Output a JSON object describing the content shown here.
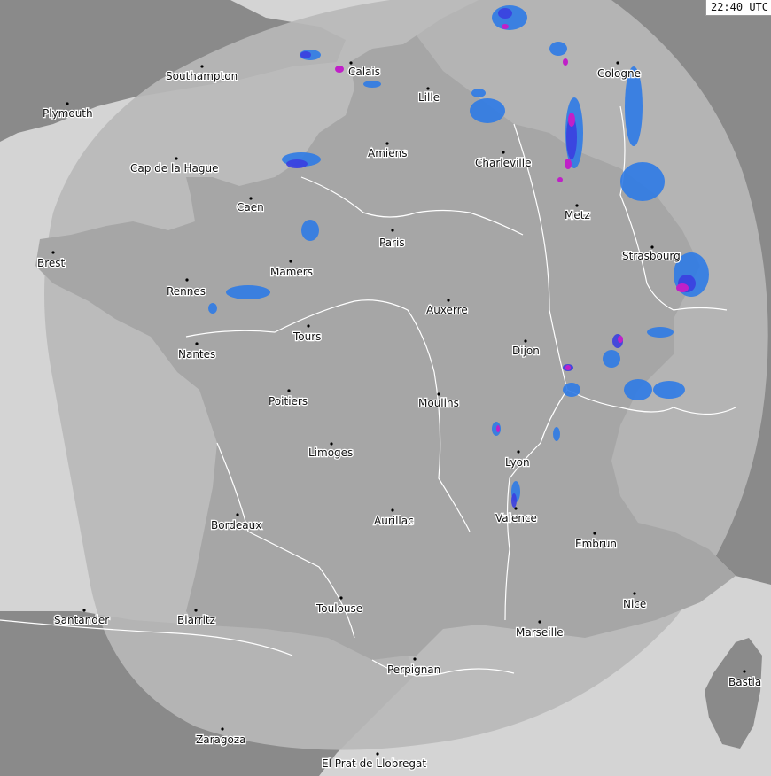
{
  "timestamp": "22:40 UTC",
  "colors": {
    "sea": "#d4d4d4",
    "foreign_land": "#8a8a8a",
    "radar_coverage": "#b8b8b8",
    "france_land": "#a6a6a6",
    "rivers_borders": "#ffffff",
    "precip_light": "#2f7be6",
    "precip_moderate": "#3b3fe0",
    "precip_heavy": "#c020c8"
  },
  "cities": [
    {
      "id": "southampton",
      "name": "Southampton"
    },
    {
      "id": "plymouth",
      "name": "Plymouth"
    },
    {
      "id": "calais",
      "name": "Calais"
    },
    {
      "id": "lille",
      "name": "Lille"
    },
    {
      "id": "cologne",
      "name": "Cologne"
    },
    {
      "id": "amiens",
      "name": "Amiens"
    },
    {
      "id": "charleville",
      "name": "Charleville"
    },
    {
      "id": "cap-de-la-hague",
      "name": "Cap de la Hague"
    },
    {
      "id": "caen",
      "name": "Caen"
    },
    {
      "id": "metz",
      "name": "Metz"
    },
    {
      "id": "paris",
      "name": "Paris"
    },
    {
      "id": "brest",
      "name": "Brest"
    },
    {
      "id": "strasbourg",
      "name": "Strasbourg"
    },
    {
      "id": "mamers",
      "name": "Mamers"
    },
    {
      "id": "rennes",
      "name": "Rennes"
    },
    {
      "id": "auxerre",
      "name": "Auxerre"
    },
    {
      "id": "tours",
      "name": "Tours"
    },
    {
      "id": "dijon",
      "name": "Dijon"
    },
    {
      "id": "nantes",
      "name": "Nantes"
    },
    {
      "id": "poitiers",
      "name": "Poitiers"
    },
    {
      "id": "moulins",
      "name": "Moulins"
    },
    {
      "id": "limoges",
      "name": "Limoges"
    },
    {
      "id": "lyon",
      "name": "Lyon"
    },
    {
      "id": "valence",
      "name": "Valence"
    },
    {
      "id": "bordeaux",
      "name": "Bordeaux"
    },
    {
      "id": "aurillac",
      "name": "Aurillac"
    },
    {
      "id": "embrun",
      "name": "Embrun"
    },
    {
      "id": "nice",
      "name": "Nice"
    },
    {
      "id": "santander",
      "name": "Santander"
    },
    {
      "id": "biarritz",
      "name": "Biarritz"
    },
    {
      "id": "toulouse",
      "name": "Toulouse"
    },
    {
      "id": "marseille",
      "name": "Marseille"
    },
    {
      "id": "perpignan",
      "name": "Perpignan"
    },
    {
      "id": "bastia",
      "name": "Bastia"
    },
    {
      "id": "zaragoza",
      "name": "Zaragoza"
    },
    {
      "id": "el-prat",
      "name": "El Prat de Llobregat"
    }
  ]
}
